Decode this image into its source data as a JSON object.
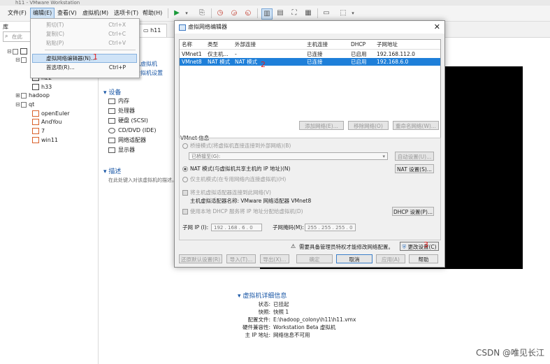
{
  "window": {
    "title": "h11 - VMware Workstation"
  },
  "menubar": {
    "items": [
      "文件(F)",
      "编辑(E)",
      "查看(V)",
      "虚拟机(M)",
      "选项卡(T)",
      "帮助(H)"
    ]
  },
  "library": {
    "title": "库",
    "search_placeholder": "在此",
    "tree": [
      "h22",
      "h33",
      "hadoop",
      "qt",
      "openEuler",
      "AndYou",
      "7",
      "win11"
    ]
  },
  "tabs": {
    "active": "h11"
  },
  "vm_page": {
    "actions": [
      "此虚拟机",
      "虚拟机设置"
    ],
    "devices_header": "设备",
    "devices": [
      "内存",
      "处理器",
      "硬盘 (SCSI)",
      "CD/DVD (IDE)",
      "网络适配器",
      "显示器"
    ],
    "desc_header": "描述",
    "desc_placeholder": "在此处键入对该虚拟机的描述。",
    "details_header": "虚拟机详细信息",
    "details": [
      {
        "label": "状态:",
        "value": "已挂起"
      },
      {
        "label": "快照:",
        "value": "快照 1"
      },
      {
        "label": "配置文件:",
        "value": "E:\\hadoop_colony\\h11\\h11.vmx"
      },
      {
        "label": "硬件兼容性:",
        "value": "Workstation Beta 虚拟机"
      },
      {
        "label": "主 IP 地址:",
        "value": "网络信息不可用"
      }
    ]
  },
  "edit_menu": {
    "items": [
      {
        "label": "剪切(T)",
        "shortcut": "Ctrl+X"
      },
      {
        "label": "复制(C)",
        "shortcut": "Ctrl+C"
      },
      {
        "label": "粘贴(P)",
        "shortcut": "Ctrl+V"
      },
      {
        "label": "虚拟网络编辑器(N)...",
        "shortcut": ""
      },
      {
        "label": "首选项(R)...",
        "shortcut": "Ctrl+P"
      }
    ]
  },
  "dialog": {
    "title": "虚拟网络编辑器",
    "columns": [
      "名称",
      "类型",
      "外部连接",
      "主机连接",
      "DHCP",
      "子网地址"
    ],
    "rows": [
      {
        "name": "VMnet1",
        "type": "仅主机...",
        "external": "-",
        "host": "已连接",
        "dhcp": "已启用",
        "subnet": "192.168.112.0"
      },
      {
        "name": "VMnet8",
        "type": "NAT 模式",
        "external": "NAT 模式",
        "host": "已连接",
        "dhcp": "已启用",
        "subnet": "192.168.6.0"
      }
    ],
    "list_buttons": [
      "添加网络(E)...",
      "移除网络(O)",
      "重命名网络(W)..."
    ],
    "info_header": "VMnet 信息",
    "bridged": "桥接模式(将虚拟机直接连接到外部网络)(B)",
    "bridged_to": "已桥接至(G):",
    "auto_btn": "自动设置(U)...",
    "nat": "NAT 模式(与虚拟机共享主机的 IP 地址)(N)",
    "nat_btn": "NAT 设置(S)...",
    "hostonly": "仅主机模式(在专用网络内连接虚拟机)(H)",
    "connect_adapter": "将主机虚拟适配器连接到此网络(V)",
    "adapter_name": "主机虚拟适配器名称: VMware 网络适配器 VMnet8",
    "use_dhcp": "使用本地 DHCP 服务将 IP 地址分配给虚拟机(D)",
    "dhcp_btn": "DHCP 设置(P)...",
    "subnet_ip_label": "子网 IP (I):",
    "subnet_ip": "192 . 168 .  6  .  0",
    "mask_label": "子网掩码(M):",
    "mask": "255 . 255 . 255 . 0",
    "admin_notice": "需要具备管理员特权才能修改网络配置。",
    "change_btn": "更改设置(C)",
    "footer_buttons": [
      "还原默认设置(R)",
      "导入(T)...",
      "导出(X)...",
      "确定",
      "取消",
      "应用(A)",
      "帮助"
    ]
  },
  "annotations": [
    "1",
    "2",
    "3"
  ],
  "watermark": "CSDN @唯见长江"
}
